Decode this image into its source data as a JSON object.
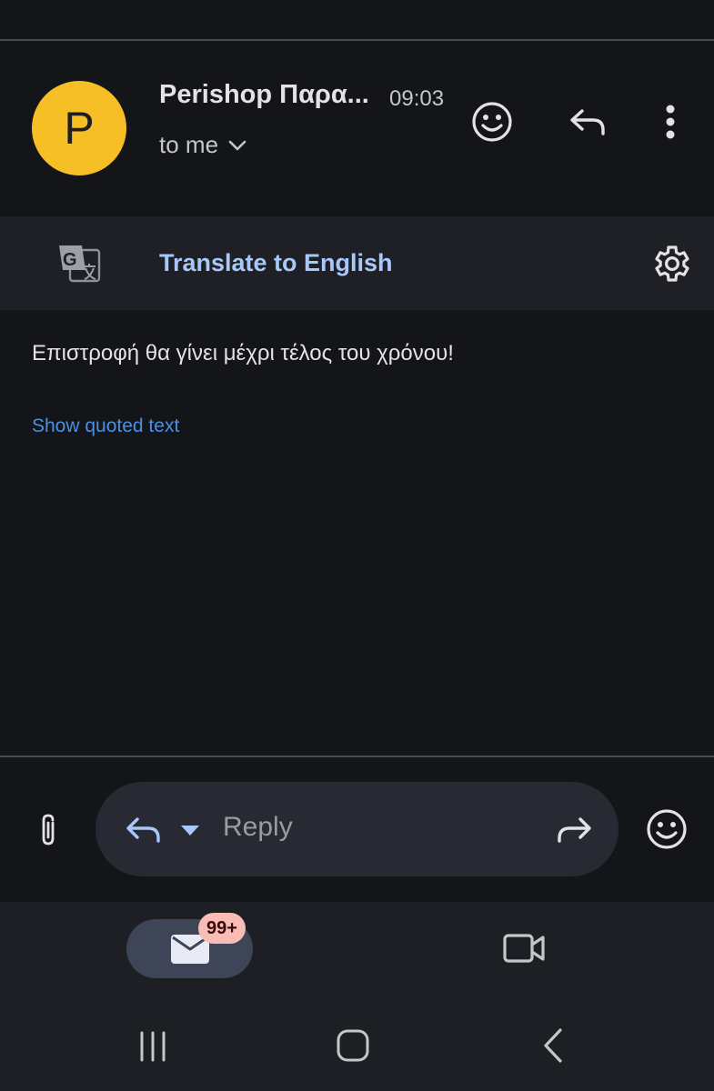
{
  "header": {
    "avatar_letter": "P",
    "sender": "Perishop Παρα...",
    "time": "09:03",
    "recipient": "to me"
  },
  "translate": {
    "label": "Translate to English"
  },
  "message": {
    "body": "Επιστροφή θα γίνει μέχρι τέλος του χρόνου!",
    "show_quoted": "Show quoted text"
  },
  "reply_bar": {
    "placeholder": "Reply"
  },
  "bottom_nav": {
    "mail_badge": "99+"
  },
  "colors": {
    "background": "#141519",
    "avatar": "#f6bf26",
    "link": "#a8c7fa",
    "quoted_link": "#4a90e2",
    "badge": "#f9bdb6"
  },
  "icons": [
    "emoji-icon",
    "reply-icon",
    "more-vert-icon",
    "google-translate-icon",
    "settings-icon",
    "attachment-icon",
    "reply-dropdown-icon",
    "forward-icon",
    "mail-icon",
    "video-icon",
    "recent-apps-icon",
    "home-icon",
    "back-icon"
  ]
}
